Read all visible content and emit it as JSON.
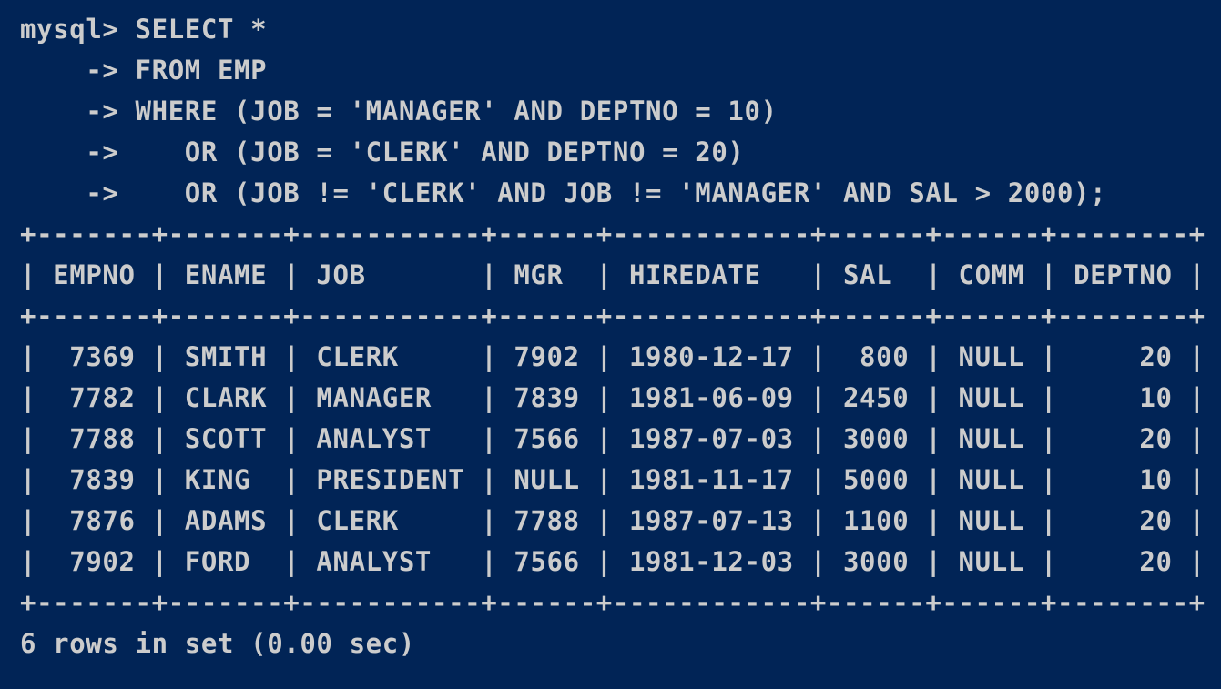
{
  "terminal": {
    "query_lines": [
      "mysql> SELECT *",
      "    -> FROM EMP",
      "    -> WHERE (JOB = 'MANAGER' AND DEPTNO = 10)",
      "    ->    OR (JOB = 'CLERK' AND DEPTNO = 20)",
      "    ->    OR (JOB != 'CLERK' AND JOB != 'MANAGER' AND SAL > 2000);"
    ],
    "table": {
      "border": "+-------+-------+-----------+------+------------+------+------+--------+",
      "header_line": "| EMPNO | ENAME | JOB       | MGR  | HIREDATE   | SAL  | COMM | DEPTNO |",
      "columns": [
        "EMPNO",
        "ENAME",
        "JOB",
        "MGR",
        "HIREDATE",
        "SAL",
        "COMM",
        "DEPTNO"
      ],
      "row_lines": [
        "|  7369 | SMITH | CLERK     | 7902 | 1980-12-17 |  800 | NULL |     20 |",
        "|  7782 | CLARK | MANAGER   | 7839 | 1981-06-09 | 2450 | NULL |     10 |",
        "|  7788 | SCOTT | ANALYST   | 7566 | 1987-07-03 | 3000 | NULL |     20 |",
        "|  7839 | KING  | PRESIDENT | NULL | 1981-11-17 | 5000 | NULL |     10 |",
        "|  7876 | ADAMS | CLERK     | 7788 | 1987-07-13 | 1100 | NULL |     20 |",
        "|  7902 | FORD  | ANALYST   | 7566 | 1981-12-03 | 3000 | NULL |     20 |"
      ]
    },
    "status": "6 rows in set (0.00 sec)"
  },
  "colors": {
    "background": "#012456",
    "text": "#cccccc"
  }
}
